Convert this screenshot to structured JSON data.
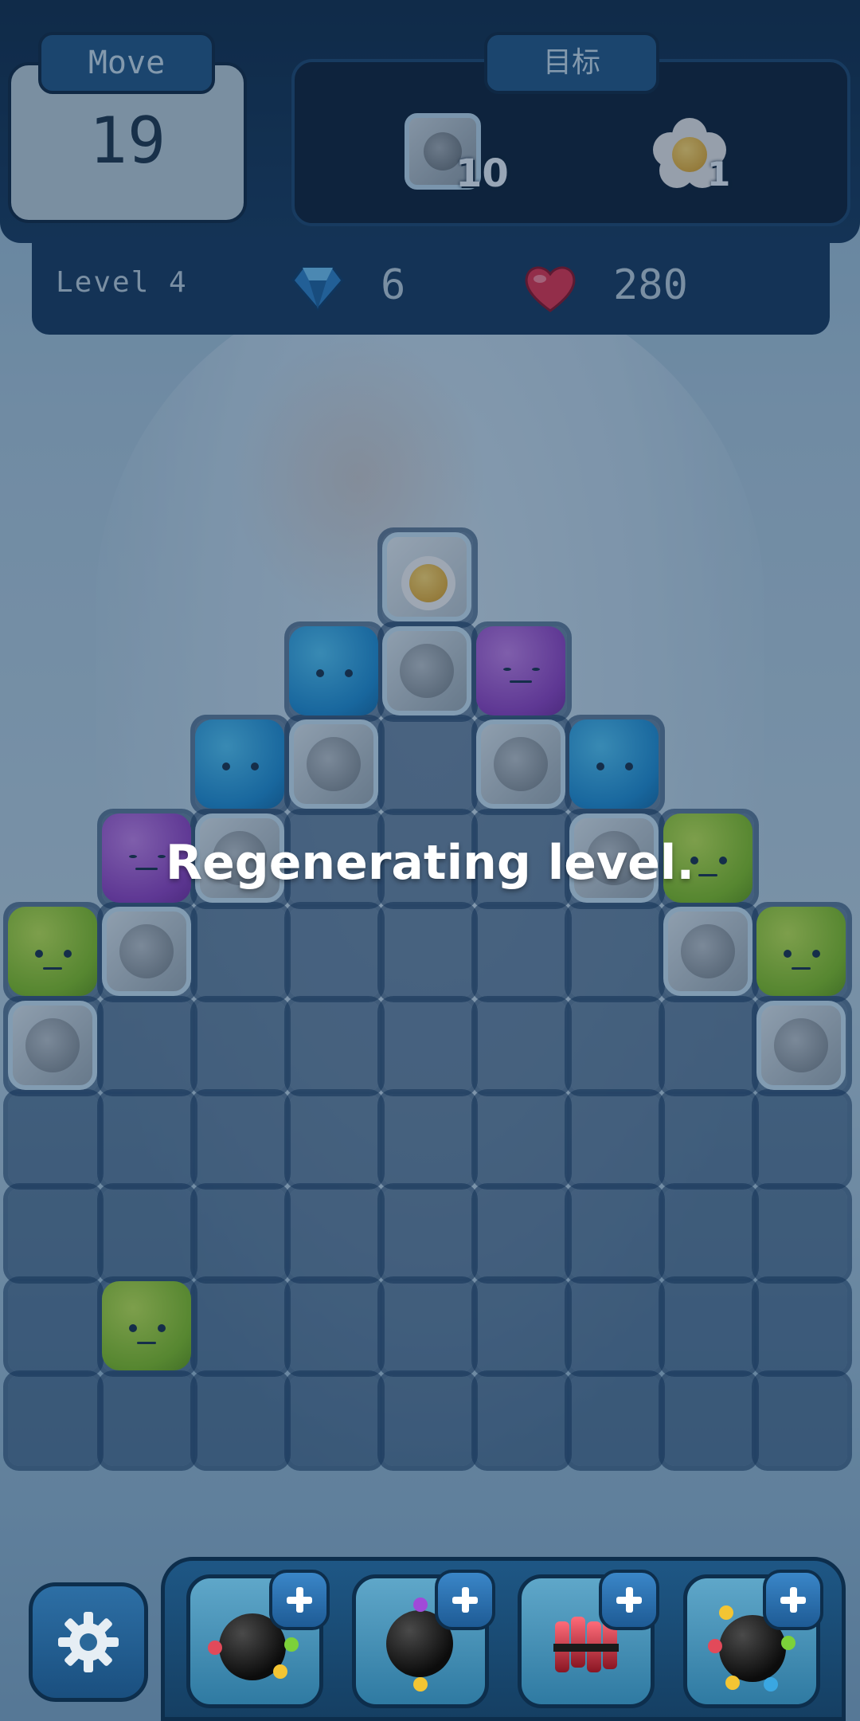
{
  "hud": {
    "move_label": "Move",
    "moves_left": "19",
    "goal_label": "目标",
    "goals": [
      {
        "name": "ice-block",
        "count": "10"
      },
      {
        "name": "flower",
        "count": "1"
      }
    ],
    "level": "Level 4",
    "gems": "6",
    "lives": "280"
  },
  "overlay": {
    "message": "Regenerating level."
  },
  "board": {
    "columns": 9,
    "rows": 10,
    "tiles": [
      {
        "col": 4,
        "row": 0,
        "kind": "flower-ice"
      },
      {
        "col": 3,
        "row": 1,
        "kind": "blue"
      },
      {
        "col": 4,
        "row": 1,
        "kind": "ice"
      },
      {
        "col": 5,
        "row": 1,
        "kind": "purple"
      },
      {
        "col": 2,
        "row": 2,
        "kind": "blue"
      },
      {
        "col": 3,
        "row": 2,
        "kind": "ice"
      },
      {
        "col": 5,
        "row": 2,
        "kind": "ice"
      },
      {
        "col": 6,
        "row": 2,
        "kind": "blue"
      },
      {
        "col": 1,
        "row": 3,
        "kind": "purple"
      },
      {
        "col": 2,
        "row": 3,
        "kind": "ice"
      },
      {
        "col": 6,
        "row": 3,
        "kind": "ice"
      },
      {
        "col": 7,
        "row": 3,
        "kind": "green"
      },
      {
        "col": 0,
        "row": 4,
        "kind": "green"
      },
      {
        "col": 1,
        "row": 4,
        "kind": "ice"
      },
      {
        "col": 7,
        "row": 4,
        "kind": "ice"
      },
      {
        "col": 8,
        "row": 4,
        "kind": "green"
      },
      {
        "col": 0,
        "row": 5,
        "kind": "ice"
      },
      {
        "col": 8,
        "row": 5,
        "kind": "ice"
      },
      {
        "col": 1,
        "row": 8,
        "kind": "green"
      }
    ]
  },
  "boosters": [
    {
      "name": "color-bomb",
      "icon": "bomb-icon"
    },
    {
      "name": "bomb",
      "icon": "bomb-icon"
    },
    {
      "name": "dynamite",
      "icon": "dynamite-icon"
    },
    {
      "name": "spiked-bomb",
      "icon": "spiked-bomb-icon"
    }
  ],
  "colors": {
    "hud_dark": "#0d2a47",
    "hud_panel": "#14385c",
    "accent_blue": "#1f5583",
    "tile_blue": "#1b8bd0",
    "tile_purple": "#8c3fc0",
    "tile_green": "#7fbe20"
  }
}
